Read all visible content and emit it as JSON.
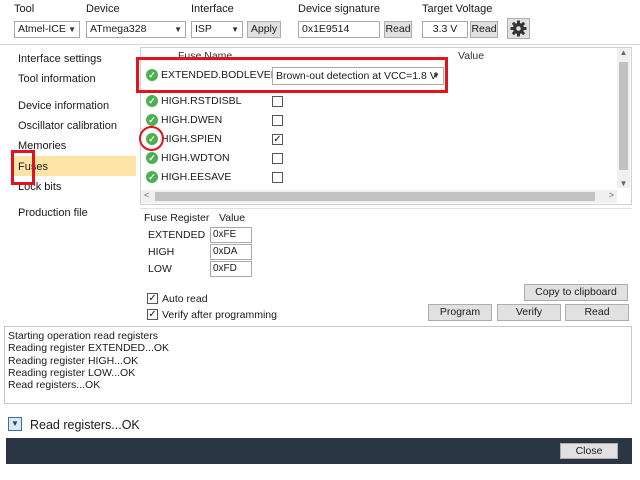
{
  "toolbar": {
    "tool_label": "Tool",
    "tool_value": "Atmel-ICE",
    "device_label": "Device",
    "device_value": "ATmega328",
    "interface_label": "Interface",
    "interface_value": "ISP",
    "apply_label": "Apply",
    "signature_label": "Device signature",
    "signature_value": "0x1E9514",
    "signature_read_label": "Read",
    "voltage_label": "Target Voltage",
    "voltage_value": "3.3 V",
    "voltage_read_label": "Read",
    "settings_icon": "gear-icon"
  },
  "sidebar": {
    "items": [
      {
        "label": "Interface settings"
      },
      {
        "label": "Tool information"
      },
      {
        "label": "Device information"
      },
      {
        "label": "Oscillator calibration"
      },
      {
        "label": "Memories"
      },
      {
        "label": "Fuses"
      },
      {
        "label": "Lock bits"
      },
      {
        "label": "Production file"
      }
    ],
    "selected": "Fuses"
  },
  "fuses": {
    "col_name": "Fuse Name",
    "col_value": "Value",
    "rows": [
      {
        "name": "EXTENDED.BODLEVEL",
        "value": "Brown-out detection at VCC=1.8 V",
        "checked": null
      },
      {
        "name": "HIGH.RSTDISBL",
        "checked": false
      },
      {
        "name": "HIGH.DWEN",
        "checked": false
      },
      {
        "name": "HIGH.SPIEN",
        "checked": true
      },
      {
        "name": "HIGH.WDTON",
        "checked": false
      },
      {
        "name": "HIGH.EESAVE",
        "checked": false
      }
    ]
  },
  "registers": {
    "col_register": "Fuse Register",
    "col_value": "Value",
    "rows": [
      {
        "name": "EXTENDED",
        "value": "0xFE"
      },
      {
        "name": "HIGH",
        "value": "0xDA"
      },
      {
        "name": "LOW",
        "value": "0xFD"
      }
    ]
  },
  "options": {
    "auto_read": "Auto read",
    "auto_read_checked": true,
    "verify": "Verify after programming",
    "verify_checked": true
  },
  "actions": {
    "copy": "Copy to clipboard",
    "program": "Program",
    "verify": "Verify",
    "read": "Read"
  },
  "log": {
    "lines": [
      "Starting operation read registers",
      "Reading register EXTENDED...OK",
      "Reading register HIGH...OK",
      "Reading register LOW...OK",
      "Read registers...OK"
    ]
  },
  "status": {
    "text": "Read registers...OK",
    "close": "Close"
  },
  "colors": {
    "selection": "#fbe4a5",
    "highlight_red": "#e0141e",
    "footer_bar": "#2b3645",
    "ok_green": "#4caf50"
  }
}
